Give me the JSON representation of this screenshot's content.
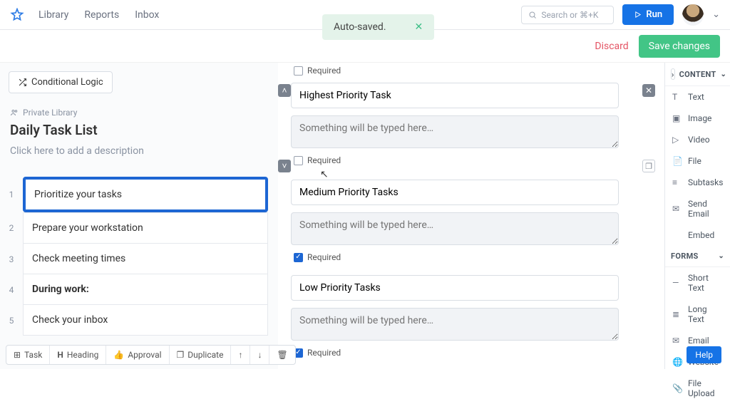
{
  "nav": {
    "library": "Library",
    "reports": "Reports",
    "inbox": "Inbox"
  },
  "search": {
    "placeholder": "Search or ⌘+K"
  },
  "run_label": "Run",
  "toast": {
    "text": "Auto-saved."
  },
  "discard": "Discard",
  "save": "Save changes",
  "conditional": "Conditional Logic",
  "private": "Private Library",
  "title": "Daily Task List",
  "desc_placeholder": "Click here to add a description",
  "steps": [
    {
      "num": "1",
      "label": "Prioritize your tasks",
      "selected": true
    },
    {
      "num": "2",
      "label": "Prepare your workstation"
    },
    {
      "num": "3",
      "label": "Check meeting times"
    },
    {
      "num": "4",
      "label": "During work:",
      "heading": true
    },
    {
      "num": "5",
      "label": "Check your inbox"
    }
  ],
  "toolbar": {
    "task": "Task",
    "heading": "Heading",
    "approval": "Approval",
    "duplicate": "Duplicate"
  },
  "fields": [
    {
      "required_label": "Required",
      "checked": false,
      "title": "Highest Priority Task",
      "placeholder": "Something will be typed here…",
      "req2_checked": false
    },
    {
      "title": "Medium Priority Tasks",
      "placeholder": "Something will be typed here…",
      "required_label": "Required",
      "req2_checked": true
    },
    {
      "title": "Low Priority Tasks",
      "placeholder": "Something will be typed here…",
      "required_label": "Required",
      "req2_checked": true
    }
  ],
  "panel": {
    "content_header": "CONTENT",
    "forms_header": "FORMS",
    "content": [
      "Text",
      "Image",
      "Video",
      "File",
      "Subtasks",
      "Send Email",
      "Embed"
    ],
    "forms": [
      "Short Text",
      "Long Text",
      "Email",
      "Website",
      "File Upload"
    ]
  },
  "help": "Help"
}
